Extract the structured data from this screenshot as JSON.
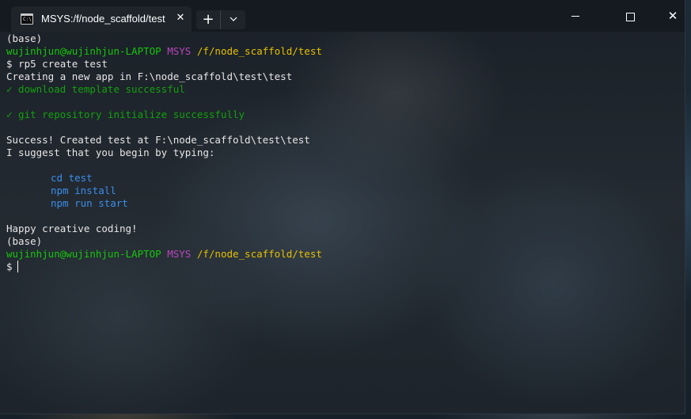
{
  "tab": {
    "title": "MSYS:/f/node_scaffold/test",
    "icon": "console-icon",
    "close_glyph": "✕"
  },
  "toolbar": {
    "new_tab_glyph": "+",
    "dropdown_glyph": "⌄"
  },
  "window_controls": {
    "close_glyph": "✕"
  },
  "terminal": {
    "colors": {
      "text": "#e6e6e6",
      "green": "#13a10e",
      "user": "#16c60c",
      "magenta": "#b847ba",
      "yellow": "#e5c000",
      "blue": "#3b8eea"
    },
    "prompt1": {
      "env": "(base)",
      "user_host": "wujinhjun@wujinhjun-LAPTOP",
      "shell": "MSYS",
      "path": "/f/node_scaffold/test",
      "symbol": "$",
      "command": "rp5 create test"
    },
    "output": {
      "creating": "Creating a new app in F:\\node_scaffold\\test\\test",
      "check1": "✓ download template successful",
      "check2": "✓ git repository initialize successfully",
      "success": "Success! Created test at F:\\node_scaffold\\test\\test",
      "suggest": "I suggest that you begin by typing:",
      "cmd1": "cd test",
      "cmd2": "npm install",
      "cmd3": "npm run start",
      "happy": "Happy creative coding!"
    },
    "prompt2": {
      "env": "(base)",
      "user_host": "wujinhjun@wujinhjun-LAPTOP",
      "shell": "MSYS",
      "path": "/f/node_scaffold/test",
      "symbol": "$"
    }
  }
}
